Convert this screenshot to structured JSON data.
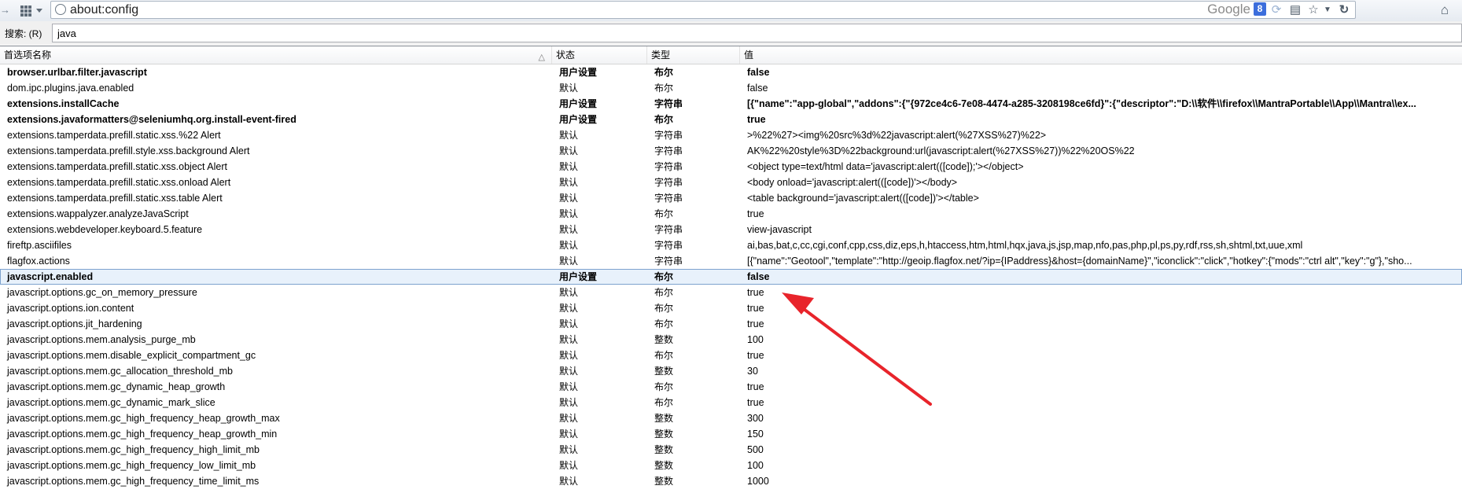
{
  "navbar": {
    "url": "about:config",
    "search_text": "Google",
    "search_engine_letter": "8",
    "icons": [
      "back-arrow-icon",
      "apps-grid-icon",
      "globe-icon",
      "sync-icon",
      "reader-icon",
      "star-icon",
      "dropdown-icon",
      "reload-icon",
      "home-icon"
    ]
  },
  "filter": {
    "label": "搜索: (R)",
    "value": "java"
  },
  "columns": {
    "name": "首选项名称",
    "status": "状态",
    "type": "类型",
    "value": "值"
  },
  "rows": [
    {
      "name": "browser.urlbar.filter.javascript",
      "status": "用户设置",
      "type": "布尔",
      "value": "false",
      "modified": true
    },
    {
      "name": "dom.ipc.plugins.java.enabled",
      "status": "默认",
      "type": "布尔",
      "value": "false",
      "modified": false
    },
    {
      "name": "extensions.installCache",
      "status": "用户设置",
      "type": "字符串",
      "value": "[{\"name\":\"app-global\",\"addons\":{\"{972ce4c6-7e08-4474-a285-3208198ce6fd}\":{\"descriptor\":\"D:\\\\软件\\\\firefox\\\\MantraPortable\\\\App\\\\Mantra\\\\ex...",
      "modified": true
    },
    {
      "name": "extensions.javaformatters@seleniumhq.org.install-event-fired",
      "status": "用户设置",
      "type": "布尔",
      "value": "true",
      "modified": true
    },
    {
      "name": "extensions.tamperdata.prefill.static.xss.%22 Alert",
      "status": "默认",
      "type": "字符串",
      "value": ">%22%27><img%20src%3d%22javascript:alert(%27XSS%27)%22>",
      "modified": false
    },
    {
      "name": "extensions.tamperdata.prefill.style.xss.background Alert",
      "status": "默认",
      "type": "字符串",
      "value": "AK%22%20style%3D%22background:url(javascript:alert(%27XSS%27))%22%20OS%22",
      "modified": false
    },
    {
      "name": "extensions.tamperdata.prefill.static.xss.object Alert",
      "status": "默认",
      "type": "字符串",
      "value": "<object type=text/html data='javascript:alert(([code]);'></object>",
      "modified": false
    },
    {
      "name": "extensions.tamperdata.prefill.static.xss.onload Alert",
      "status": "默认",
      "type": "字符串",
      "value": "<body onload='javascript:alert(([code])'></body>",
      "modified": false
    },
    {
      "name": "extensions.tamperdata.prefill.static.xss.table Alert",
      "status": "默认",
      "type": "字符串",
      "value": "<table background='javascript:alert(([code])'></table>",
      "modified": false
    },
    {
      "name": "extensions.wappalyzer.analyzeJavaScript",
      "status": "默认",
      "type": "布尔",
      "value": "true",
      "modified": false
    },
    {
      "name": "extensions.webdeveloper.keyboard.5.feature",
      "status": "默认",
      "type": "字符串",
      "value": "view-javascript",
      "modified": false
    },
    {
      "name": "fireftp.asciifiles",
      "status": "默认",
      "type": "字符串",
      "value": "ai,bas,bat,c,cc,cgi,conf,cpp,css,diz,eps,h,htaccess,htm,html,hqx,java,js,jsp,map,nfo,pas,php,pl,ps,py,rdf,rss,sh,shtml,txt,uue,xml",
      "modified": false
    },
    {
      "name": "flagfox.actions",
      "status": "默认",
      "type": "字符串",
      "value": "[{\"name\":\"Geotool\",\"template\":\"http://geoip.flagfox.net/?ip={IPaddress}&host={domainName}\",\"iconclick\":\"click\",\"hotkey\":{\"mods\":\"ctrl alt\",\"key\":\"g\"},\"sho...",
      "modified": false
    },
    {
      "name": "javascript.enabled",
      "status": "用户设置",
      "type": "布尔",
      "value": "false",
      "modified": true,
      "selected": true
    },
    {
      "name": "javascript.options.gc_on_memory_pressure",
      "status": "默认",
      "type": "布尔",
      "value": "true",
      "modified": false
    },
    {
      "name": "javascript.options.ion.content",
      "status": "默认",
      "type": "布尔",
      "value": "true",
      "modified": false
    },
    {
      "name": "javascript.options.jit_hardening",
      "status": "默认",
      "type": "布尔",
      "value": "true",
      "modified": false
    },
    {
      "name": "javascript.options.mem.analysis_purge_mb",
      "status": "默认",
      "type": "整数",
      "value": "100",
      "modified": false
    },
    {
      "name": "javascript.options.mem.disable_explicit_compartment_gc",
      "status": "默认",
      "type": "布尔",
      "value": "true",
      "modified": false
    },
    {
      "name": "javascript.options.mem.gc_allocation_threshold_mb",
      "status": "默认",
      "type": "整数",
      "value": "30",
      "modified": false
    },
    {
      "name": "javascript.options.mem.gc_dynamic_heap_growth",
      "status": "默认",
      "type": "布尔",
      "value": "true",
      "modified": false
    },
    {
      "name": "javascript.options.mem.gc_dynamic_mark_slice",
      "status": "默认",
      "type": "布尔",
      "value": "true",
      "modified": false
    },
    {
      "name": "javascript.options.mem.gc_high_frequency_heap_growth_max",
      "status": "默认",
      "type": "整数",
      "value": "300",
      "modified": false
    },
    {
      "name": "javascript.options.mem.gc_high_frequency_heap_growth_min",
      "status": "默认",
      "type": "整数",
      "value": "150",
      "modified": false
    },
    {
      "name": "javascript.options.mem.gc_high_frequency_high_limit_mb",
      "status": "默认",
      "type": "整数",
      "value": "500",
      "modified": false
    },
    {
      "name": "javascript.options.mem.gc_high_frequency_low_limit_mb",
      "status": "默认",
      "type": "整数",
      "value": "100",
      "modified": false
    },
    {
      "name": "javascript.options.mem.gc_high_frequency_time_limit_ms",
      "status": "默认",
      "type": "整数",
      "value": "1000",
      "modified": false
    }
  ],
  "annotation": {
    "arrow_color": "#e8242b"
  }
}
